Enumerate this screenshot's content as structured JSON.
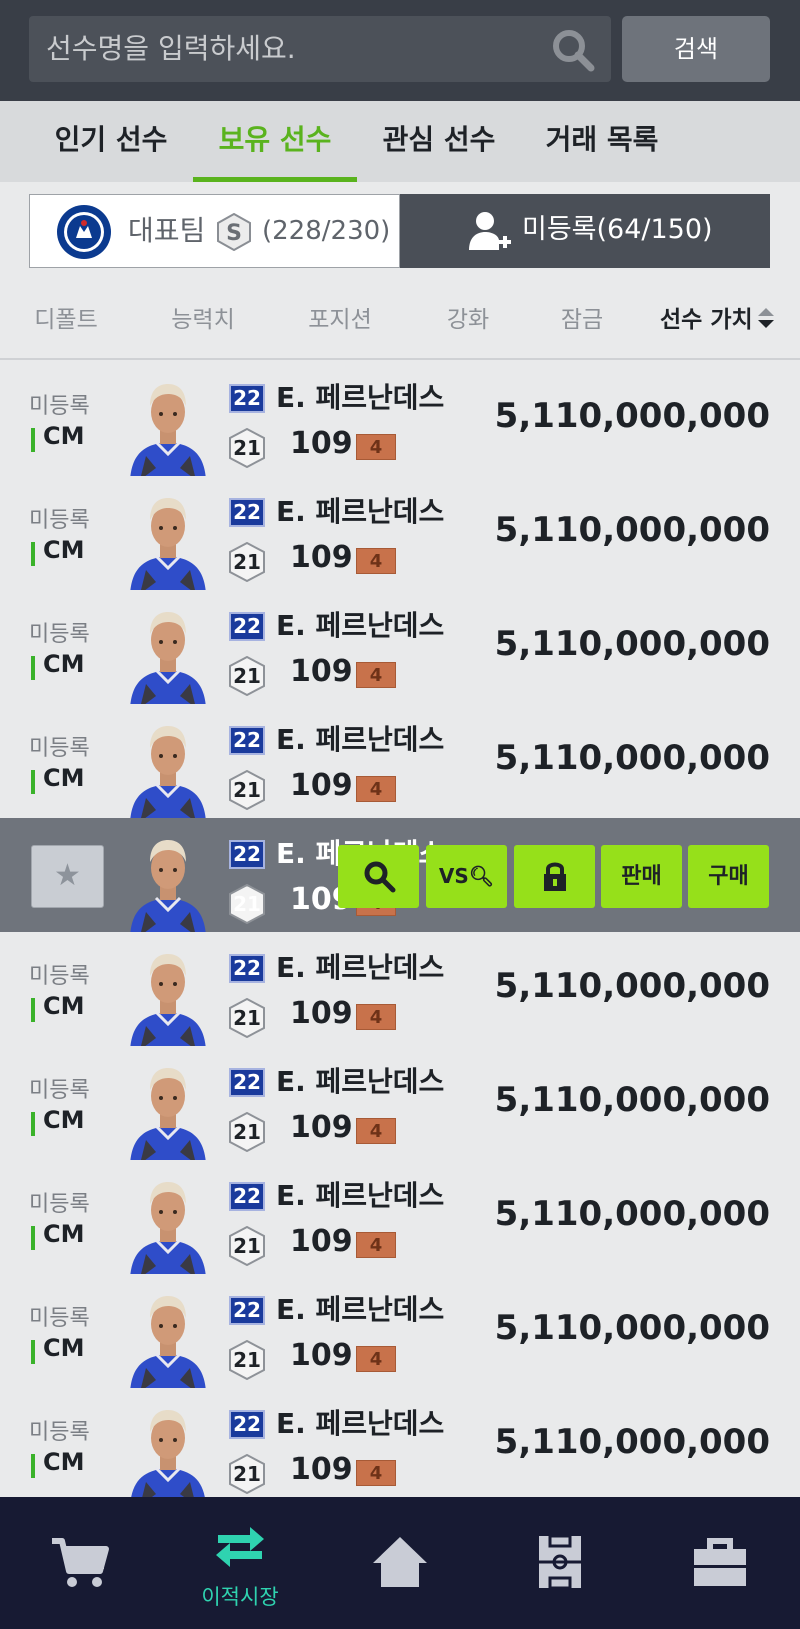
{
  "search": {
    "placeholder": "선수명을 입력하세요.",
    "button_label": "검색"
  },
  "tabs": [
    {
      "label": "인기 선수",
      "active": false
    },
    {
      "label": "보유 선수",
      "active": true
    },
    {
      "label": "관심 선수",
      "active": false
    },
    {
      "label": "거래 목록",
      "active": false
    }
  ],
  "team": {
    "label": "대표팀",
    "count": "(228/230)",
    "logo_icon": "chelsea-logo",
    "badge_letter": "S"
  },
  "unregistered": {
    "label": "미등록(64/150)",
    "icon": "add-user-icon"
  },
  "sort": {
    "items": [
      "디폴트",
      "능력치",
      "포지션",
      "강화",
      "잠금",
      "선수 가치"
    ],
    "active": "선수 가치"
  },
  "players": [
    {
      "status": "미등록",
      "position": "CM",
      "season": "22",
      "name": "E. 페르난데스",
      "grade": "21",
      "ovr": "109",
      "upgrade": "4",
      "price": "5,110,000,000"
    },
    {
      "status": "미등록",
      "position": "CM",
      "season": "22",
      "name": "E. 페르난데스",
      "grade": "21",
      "ovr": "109",
      "upgrade": "4",
      "price": "5,110,000,000"
    },
    {
      "status": "미등록",
      "position": "CM",
      "season": "22",
      "name": "E. 페르난데스",
      "grade": "21",
      "ovr": "109",
      "upgrade": "4",
      "price": "5,110,000,000"
    },
    {
      "status": "미등록",
      "position": "CM",
      "season": "22",
      "name": "E. 페르난데스",
      "grade": "21",
      "ovr": "109",
      "upgrade": "4",
      "price": "5,110,000,000"
    },
    {
      "status": "",
      "position": "",
      "season": "22",
      "name": "E. 페르난데스",
      "grade": "21",
      "ovr": "109",
      "upgrade": "4",
      "price": ""
    },
    {
      "status": "미등록",
      "position": "CM",
      "season": "22",
      "name": "E. 페르난데스",
      "grade": "21",
      "ovr": "109",
      "upgrade": "4",
      "price": "5,110,000,000"
    },
    {
      "status": "미등록",
      "position": "CM",
      "season": "22",
      "name": "E. 페르난데스",
      "grade": "21",
      "ovr": "109",
      "upgrade": "4",
      "price": "5,110,000,000"
    },
    {
      "status": "미등록",
      "position": "CM",
      "season": "22",
      "name": "E. 페르난데스",
      "grade": "21",
      "ovr": "109",
      "upgrade": "4",
      "price": "5,110,000,000"
    },
    {
      "status": "미등록",
      "position": "CM",
      "season": "22",
      "name": "E. 페르난데스",
      "grade": "21",
      "ovr": "109",
      "upgrade": "4",
      "price": "5,110,000,000"
    },
    {
      "status": "미등록",
      "position": "CM",
      "season": "22",
      "name": "E. 페르난데스",
      "grade": "21",
      "ovr": "109",
      "upgrade": "4",
      "price": "5,110,000,000"
    }
  ],
  "selected_row_actions": {
    "favorite_icon": "star-icon",
    "buttons": [
      {
        "icon": "search-icon",
        "label": ""
      },
      {
        "icon": "compare-icon",
        "label": "VS"
      },
      {
        "icon": "lock-icon",
        "label": ""
      },
      {
        "icon": "",
        "label": "판매"
      },
      {
        "icon": "",
        "label": "구매"
      }
    ]
  },
  "bottom_nav": [
    {
      "icon": "cart-icon",
      "label": ""
    },
    {
      "icon": "transfer-icon",
      "label": "이적시장",
      "active": true
    },
    {
      "icon": "home-icon",
      "label": ""
    },
    {
      "icon": "field-icon",
      "label": ""
    },
    {
      "icon": "bag-icon",
      "label": ""
    }
  ],
  "colors": {
    "accent_green": "#5ab31e",
    "action_lime": "#96e01a",
    "nav_bg": "#171a33",
    "nav_active": "#2fd3b0",
    "season_badge": "#1a3a9c",
    "upgrade_badge": "#c8724b"
  }
}
